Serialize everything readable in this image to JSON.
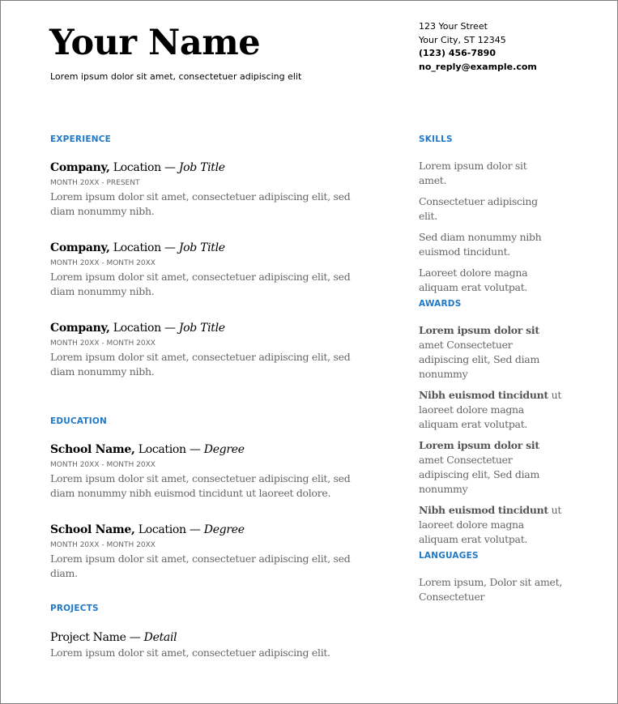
{
  "header": {
    "name": "Your Name",
    "tagline": "Lorem ipsum dolor sit amet, consectetuer adipiscing elit",
    "contact": {
      "street": "123 Your Street",
      "city": "Your City, ST 12345",
      "phone": "(123) 456-7890",
      "email": "no_reply@example.com"
    }
  },
  "experience": {
    "heading": "EXPERIENCE",
    "items": [
      {
        "org": "Company,",
        "location": " Location — ",
        "role": "Job Title",
        "dates": "MONTH 20XX - PRESENT",
        "desc": "Lorem ipsum dolor sit amet, consectetuer adipiscing elit, sed diam nonummy nibh."
      },
      {
        "org": "Company,",
        "location": " Location — ",
        "role": "Job Title",
        "dates": "MONTH 20XX - MONTH 20XX",
        "desc": "Lorem ipsum dolor sit amet, consectetuer adipiscing elit, sed diam nonummy nibh."
      },
      {
        "org": "Company,",
        "location": " Location — ",
        "role": "Job Title",
        "dates": "MONTH 20XX - MONTH 20XX",
        "desc": "Lorem ipsum dolor sit amet, consectetuer adipiscing elit, sed diam nonummy nibh."
      }
    ]
  },
  "education": {
    "heading": "EDUCATION",
    "items": [
      {
        "org": "School Name,",
        "location": " Location — ",
        "role": "Degree",
        "dates": "MONTH 20XX - MONTH 20XX",
        "desc": "Lorem ipsum dolor sit amet, consectetuer adipiscing elit, sed diam nonummy nibh euismod tincidunt ut laoreet dolore."
      },
      {
        "org": "School Name,",
        "location": " Location — ",
        "role": "Degree",
        "dates": "MONTH 20XX - MONTH 20XX",
        "desc": "Lorem ipsum dolor sit amet, consectetuer adipiscing elit, sed diam."
      }
    ]
  },
  "projects": {
    "heading": "PROJECTS",
    "items": [
      {
        "name": "Project Name — ",
        "detail": "Detail",
        "desc": "Lorem ipsum dolor sit amet, consectetuer adipiscing elit."
      }
    ]
  },
  "skills": {
    "heading": "SKILLS",
    "items": [
      "Lorem ipsum dolor sit amet.",
      "Consectetuer adipiscing elit.",
      "Sed diam nonummy nibh euismod tincidunt.",
      "Laoreet dolore magna aliquam erat volutpat."
    ]
  },
  "awards": {
    "heading": "AWARDS",
    "items": [
      {
        "bold": "Lorem ipsum dolor sit",
        "rest": " amet Consectetuer adipiscing elit, Sed diam nonummy"
      },
      {
        "bold": "Nibh euismod tincidunt",
        "rest": " ut laoreet dolore magna aliquam erat volutpat."
      },
      {
        "bold": "Lorem ipsum dolor sit",
        "rest": " amet Consectetuer adipiscing elit, Sed diam nonummy"
      },
      {
        "bold": "Nibh euismod tincidunt",
        "rest": " ut laoreet dolore magna aliquam erat volutpat."
      }
    ]
  },
  "languages": {
    "heading": "LANGUAGES",
    "text": "Lorem ipsum, Dolor sit amet, Consectetuer"
  }
}
